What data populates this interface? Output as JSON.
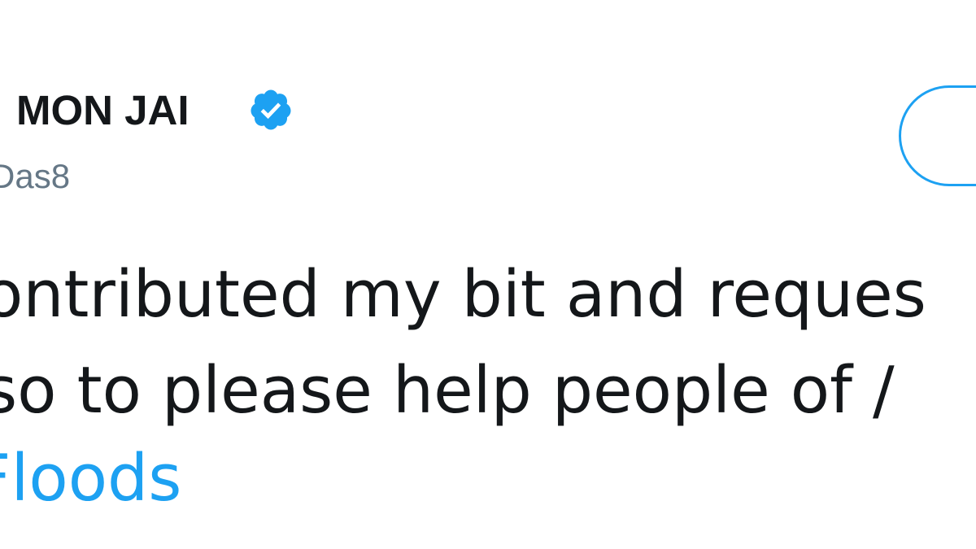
{
  "tweet": {
    "author": {
      "display_name": "MON JAI",
      "handle": "Das8",
      "verified_icon": "verified-badge-icon"
    },
    "follow_button": {
      "label": ""
    },
    "body": {
      "line1": "ontributed my bit and reques",
      "line2": "so to please help people of /",
      "hashtag": "Floods"
    }
  },
  "colors": {
    "accent": "#1da1f2",
    "text_primary": "#14171a",
    "text_secondary": "#657786",
    "background": "#ffffff"
  }
}
